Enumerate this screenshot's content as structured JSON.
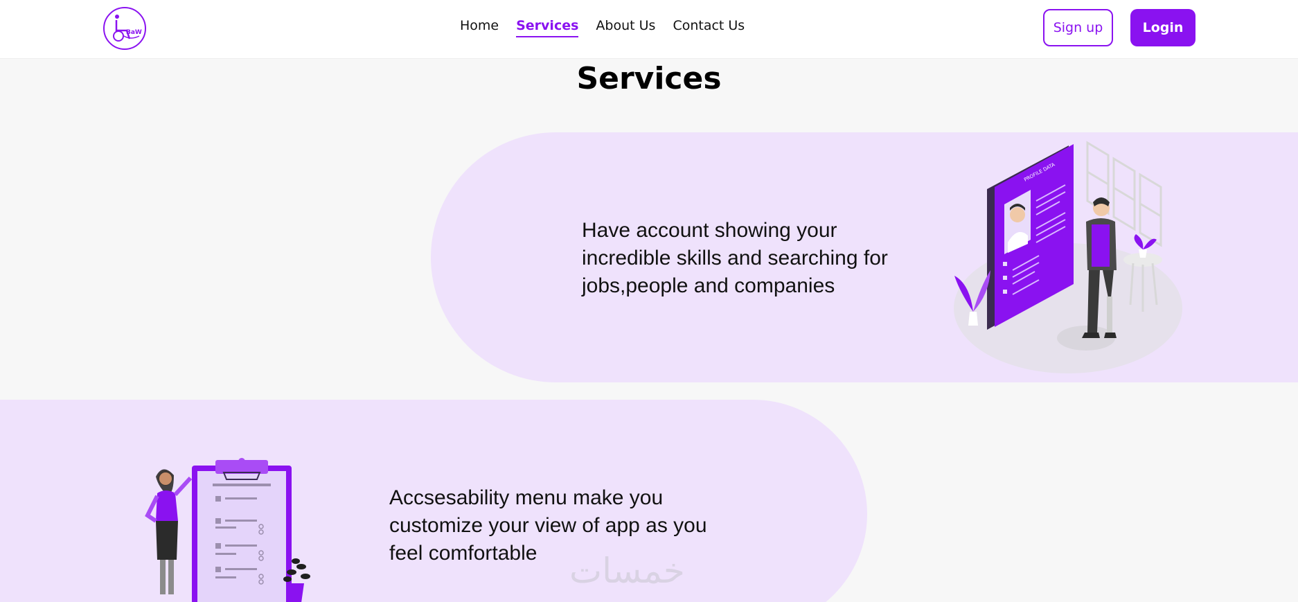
{
  "brand": {
    "logo_text": "BaW",
    "accent_color": "#8a12f0",
    "band_color": "#efe2fc"
  },
  "nav": {
    "links": [
      {
        "label": "Home",
        "active": false
      },
      {
        "label": "Services",
        "active": true
      },
      {
        "label": "About Us",
        "active": false
      },
      {
        "label": "Contact Us",
        "active": false
      }
    ],
    "signup_label": "Sign up",
    "login_label": "Login"
  },
  "page": {
    "title": "Services"
  },
  "services": [
    {
      "text": "Have account showing your incredible skills and searching for jobs,people and companies",
      "illustration_label": "PROFILE DATA",
      "illustration_icon": "profile-data-illustration"
    },
    {
      "text": "Accsesability menu make you customize your view of app as you feel comfortable",
      "illustration_icon": "clipboard-checklist-illustration"
    }
  ],
  "watermark": "خمسات"
}
